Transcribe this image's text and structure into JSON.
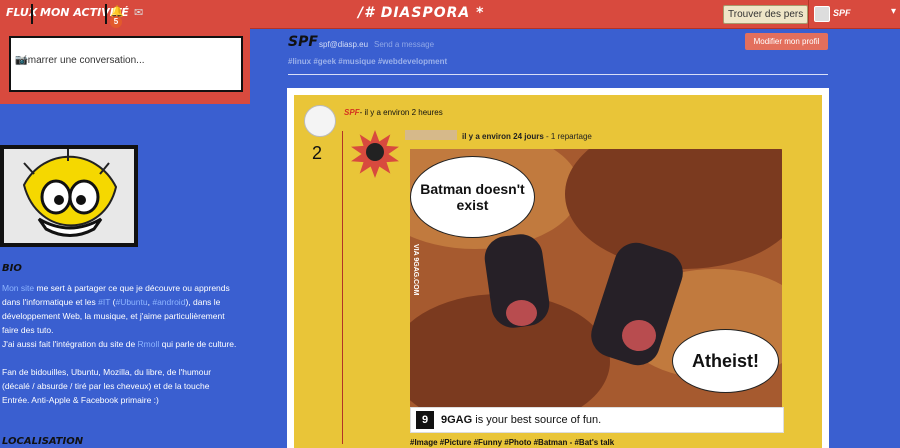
{
  "topbar": {
    "flux": "FLUX",
    "activity": "MON ACTIVITÉ",
    "notifications_count": "5",
    "brand": "/# DIASPORA *",
    "find_people": "Trouver des pers",
    "user_name": "SPF",
    "chevron": "▾",
    "icons": [
      "bell-icon",
      "mail-icon",
      "chevron-down-icon"
    ]
  },
  "publisher": {
    "placeholder": "Démarrer une conversation...",
    "camera": "📷"
  },
  "profile": {
    "bio_heading": "BIO",
    "bio": [
      [
        "Mon site",
        "link"
      ],
      [
        " me sert à partager ce que je découvre ou apprends dans l'informatique et les ",
        "text"
      ],
      [
        "#IT",
        "link"
      ],
      [
        " (",
        "text"
      ],
      [
        "#Ubuntu",
        "link"
      ],
      [
        ", ",
        "text"
      ],
      [
        "#android",
        "link"
      ],
      [
        "), dans le développement Web, la musique, et j'aime particulièrement faire des tuto.",
        "text"
      ],
      [
        "J'ai aussi fait l'intégration du site de ",
        "text"
      ],
      [
        "Rmoll",
        "link"
      ],
      [
        " qui parle de culture.",
        "text"
      ],
      [
        "Fan de bidouilles, Ubuntu, Mozilla, du libre, de l'humour (décalé / absurde / tiré par les cheveux) et de la touche Entrée. Anti-Apple & Facebook primaire :)",
        "text"
      ]
    ],
    "location_heading": "LOCALISATION"
  },
  "main": {
    "name": "SPF",
    "handle": "spf@diasp.eu",
    "message_link": "Send a message",
    "tags": "#linux #geek #musique #webdevelopment",
    "edit_profile": "Modifier mon profil",
    "post": {
      "author": "SPF",
      "time": "- il y a environ 2 heures",
      "reshare_count": "2",
      "inner_time": "il y a environ 24 jours",
      "inner_reshare": " - 1 repartage",
      "bubble_left": "Batman doesn't exist",
      "bubble_right": "Atheist!",
      "watermark": "VIA 9GAG.COM",
      "footer_logo": "9",
      "footer_brand": "9GAG",
      "footer_text": " is your best source of fun.",
      "tags": "#Image #Picture #Funny #Photo #Batman - #Bat's talk"
    }
  }
}
